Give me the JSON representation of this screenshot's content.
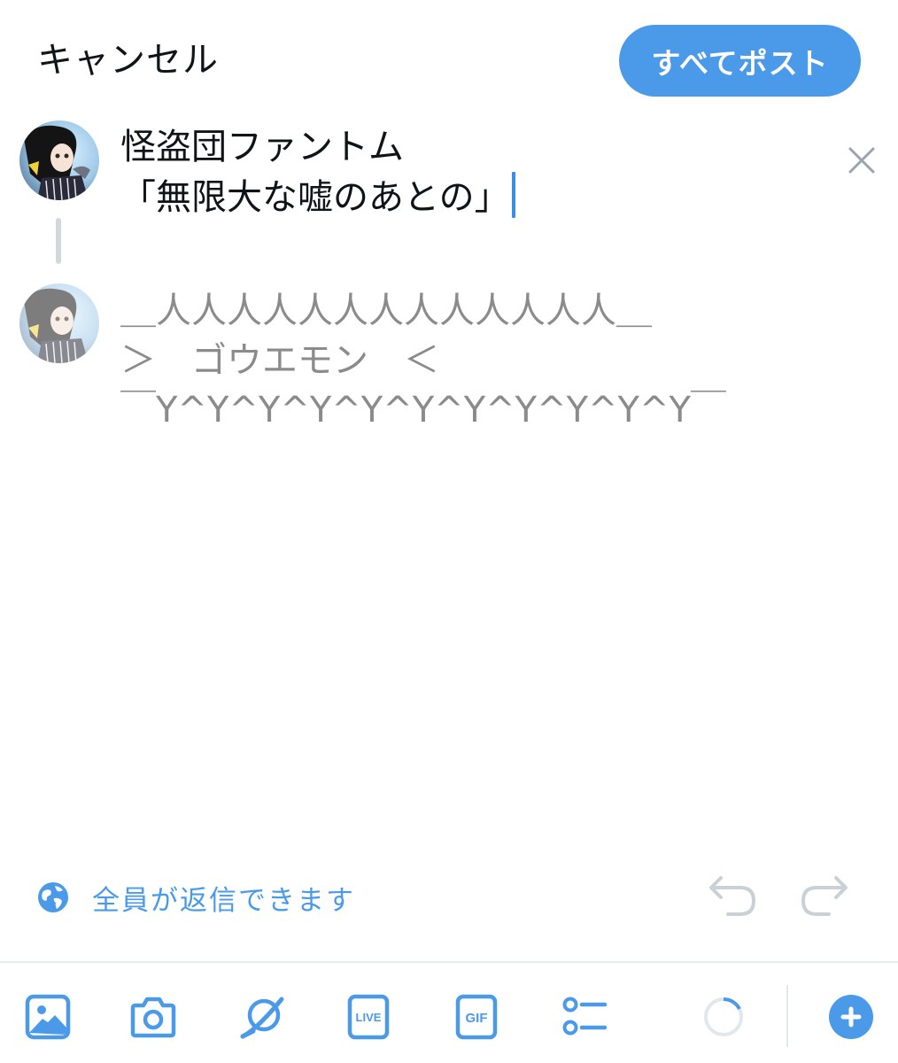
{
  "header": {
    "cancel_label": "キャンセル",
    "post_all_label": "すべてポスト"
  },
  "thread": {
    "first_line1": "怪盗団ファントム",
    "first_line2": "「無限大な嘘のあとの」",
    "second_line1": "＿人人人人人人人人人人人人人＿",
    "second_line2": "＞　ゴウエモン　＜",
    "second_line3": "￣Y^Y^Y^Y^Y^Y^Y^Y^Y^Y^Y￣"
  },
  "reply_setting": {
    "label": "全員が返信できます",
    "icon": "globe-icon"
  },
  "toolbar": {
    "live_text": "LIVE",
    "gif_text": "GIF",
    "icons": [
      "image-icon",
      "camera-icon",
      "planet-icon",
      "live-icon",
      "gif-icon",
      "poll-icon",
      "character-count-ring",
      "add-tweet-icon"
    ]
  },
  "colors": {
    "accent": "#4a9ae9",
    "text": "#0f1419",
    "placeholder": "#8b8b8b",
    "muted": "#cfd9de"
  }
}
